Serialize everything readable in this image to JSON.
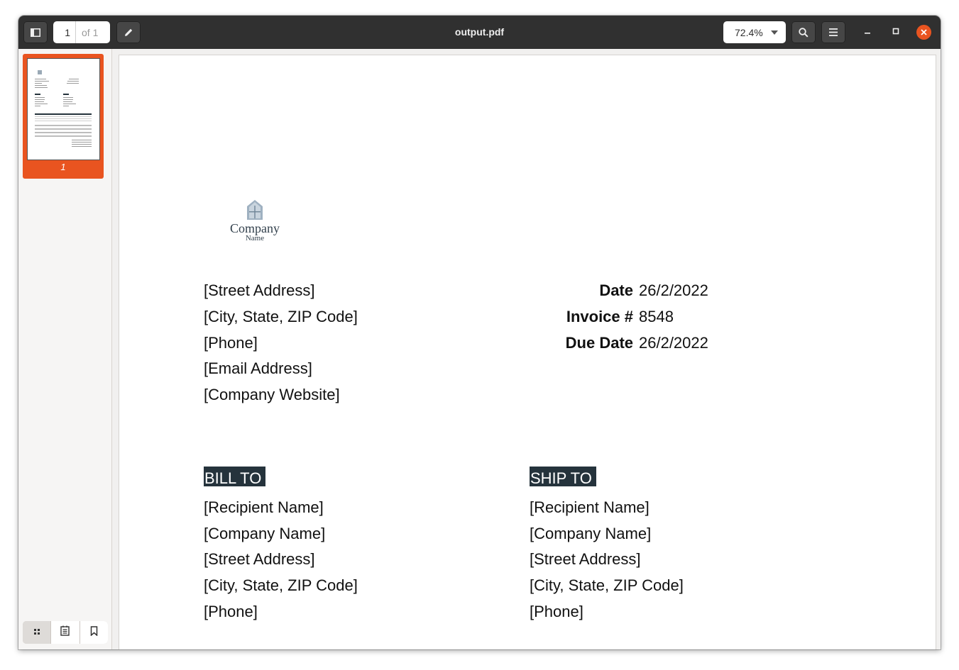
{
  "header": {
    "title": "output.pdf",
    "page_current": "1",
    "page_total_label": "of 1",
    "zoom": "72.4%"
  },
  "sidebar": {
    "thumbnail_label": "1"
  },
  "invoice": {
    "logo_line1": "Company",
    "logo_line2": "Name",
    "sender": [
      "[Street Address]",
      "[City, State, ZIP Code]",
      "[Phone]",
      "[Email Address]",
      "[Company Website]"
    ],
    "meta": [
      {
        "label": "Date",
        "value": "26/2/2022"
      },
      {
        "label": "Invoice #",
        "value": "8548"
      },
      {
        "label": "Due Date",
        "value": "26/2/2022"
      }
    ],
    "bill_to": {
      "heading": "BILL TO",
      "lines": [
        "[Recipient Name]",
        "[Company Name]",
        "[Street Address]",
        "[City, State, ZIP Code]",
        "[Phone]"
      ]
    },
    "ship_to": {
      "heading": "SHIP TO",
      "lines": [
        "[Recipient Name]",
        "[Company Name]",
        "[Street Address]",
        "[City, State, ZIP Code]",
        "[Phone]"
      ]
    }
  },
  "colors": {
    "accent": "#e95420",
    "headerbar": "#303030",
    "section_head": "#25333c"
  }
}
